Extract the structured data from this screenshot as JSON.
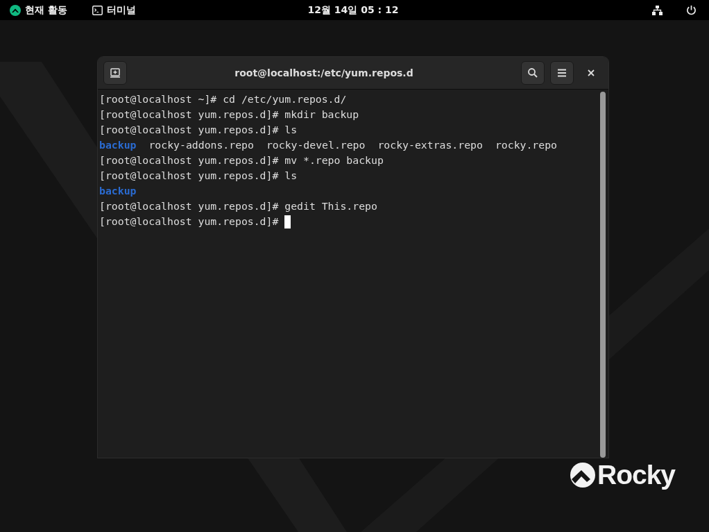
{
  "top_bar": {
    "activities": "현재 활동",
    "app_name": "터미널",
    "clock": "12월 14일 05 : 12"
  },
  "window": {
    "title": "root@localhost:/etc/yum.repos.d"
  },
  "terminal": {
    "lines": [
      {
        "segments": [
          {
            "kind": "text",
            "text": "[root@localhost ~]# cd /etc/yum.repos.d/"
          }
        ]
      },
      {
        "segments": [
          {
            "kind": "text",
            "text": "[root@localhost yum.repos.d]# mkdir backup"
          }
        ]
      },
      {
        "segments": [
          {
            "kind": "text",
            "text": "[root@localhost yum.repos.d]# ls"
          }
        ]
      },
      {
        "segments": [
          {
            "kind": "dir",
            "text": "backup"
          },
          {
            "kind": "text",
            "text": "rocky-addons.repo"
          },
          {
            "kind": "text",
            "text": "rocky-devel.repo"
          },
          {
            "kind": "text",
            "text": "rocky-extras.repo"
          },
          {
            "kind": "text",
            "text": "rocky.repo"
          }
        ]
      },
      {
        "segments": [
          {
            "kind": "text",
            "text": "[root@localhost yum.repos.d]# mv *.repo backup"
          }
        ]
      },
      {
        "segments": [
          {
            "kind": "text",
            "text": "[root@localhost yum.repos.d]# ls"
          }
        ]
      },
      {
        "segments": [
          {
            "kind": "dir",
            "text": "backup"
          }
        ]
      },
      {
        "segments": [
          {
            "kind": "text",
            "text": "[root@localhost yum.repos.d]# gedit This.repo"
          }
        ]
      },
      {
        "segments": [
          {
            "kind": "text",
            "text": "[root@localhost yum.repos.d]#"
          }
        ]
      }
    ]
  },
  "logo": {
    "text": "Rocky"
  }
}
